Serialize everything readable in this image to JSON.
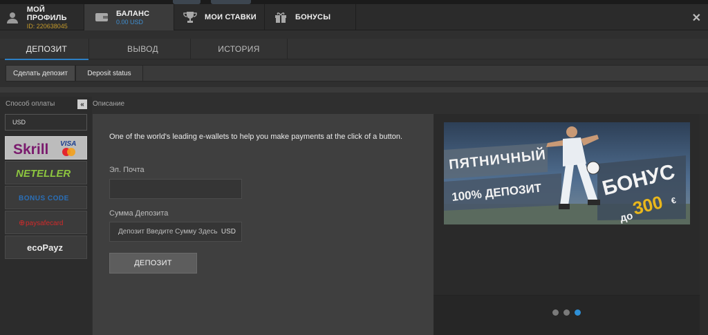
{
  "header": {
    "tabs": [
      {
        "title": "МОЙ ПРОФИЛЬ",
        "sub": "ID: 220638045",
        "icon": "user-icon"
      },
      {
        "title": "БАЛАНС",
        "sub": "0.00 USD",
        "icon": "wallet-icon"
      },
      {
        "title": "МОИ СТАВКИ",
        "icon": "trophy-icon"
      },
      {
        "title": "БОНУСЫ",
        "icon": "gift-icon"
      }
    ],
    "close_icon": "close-icon"
  },
  "subtabs": [
    "ДЕПОЗИТ",
    "ВЫВОД",
    "ИСТОРИЯ"
  ],
  "actions": [
    "Сделать депозит",
    "Deposit status"
  ],
  "left": {
    "payment_label": "Способ оплаты",
    "collapse_glyph": "«",
    "currency": "USD",
    "methods": [
      {
        "name": "Skrill",
        "sub": "VISA"
      },
      {
        "name": "NETELLER"
      },
      {
        "name": "BONUS CODE"
      },
      {
        "name": "paysafecard",
        "prefix": "⊕"
      },
      {
        "name": "ecoPayz"
      }
    ]
  },
  "description_label": "Описание",
  "form": {
    "description": "One of the world's leading e-wallets to help you make payments at the click of a button.",
    "email_label": "Эл. Почта",
    "email_value": "",
    "amount_label": "Сумма Депозита",
    "amount_placeholder": "Депозит Введите Сумму Здесь",
    "amount_currency": "USD",
    "submit": "ДЕПОЗИТ"
  },
  "banner": {
    "line1": "ПЯТНИЧНЫЙ",
    "line2": "100% ДЕПОЗИТ",
    "line3": "БОНУС",
    "line4": "до",
    "line5": "300",
    "line6": "€"
  },
  "carousel": {
    "active_index": 2,
    "count": 3
  },
  "colors": {
    "accent": "#2c7fc5",
    "gold": "#c59a2b",
    "active_dot": "#2e8fd6"
  }
}
